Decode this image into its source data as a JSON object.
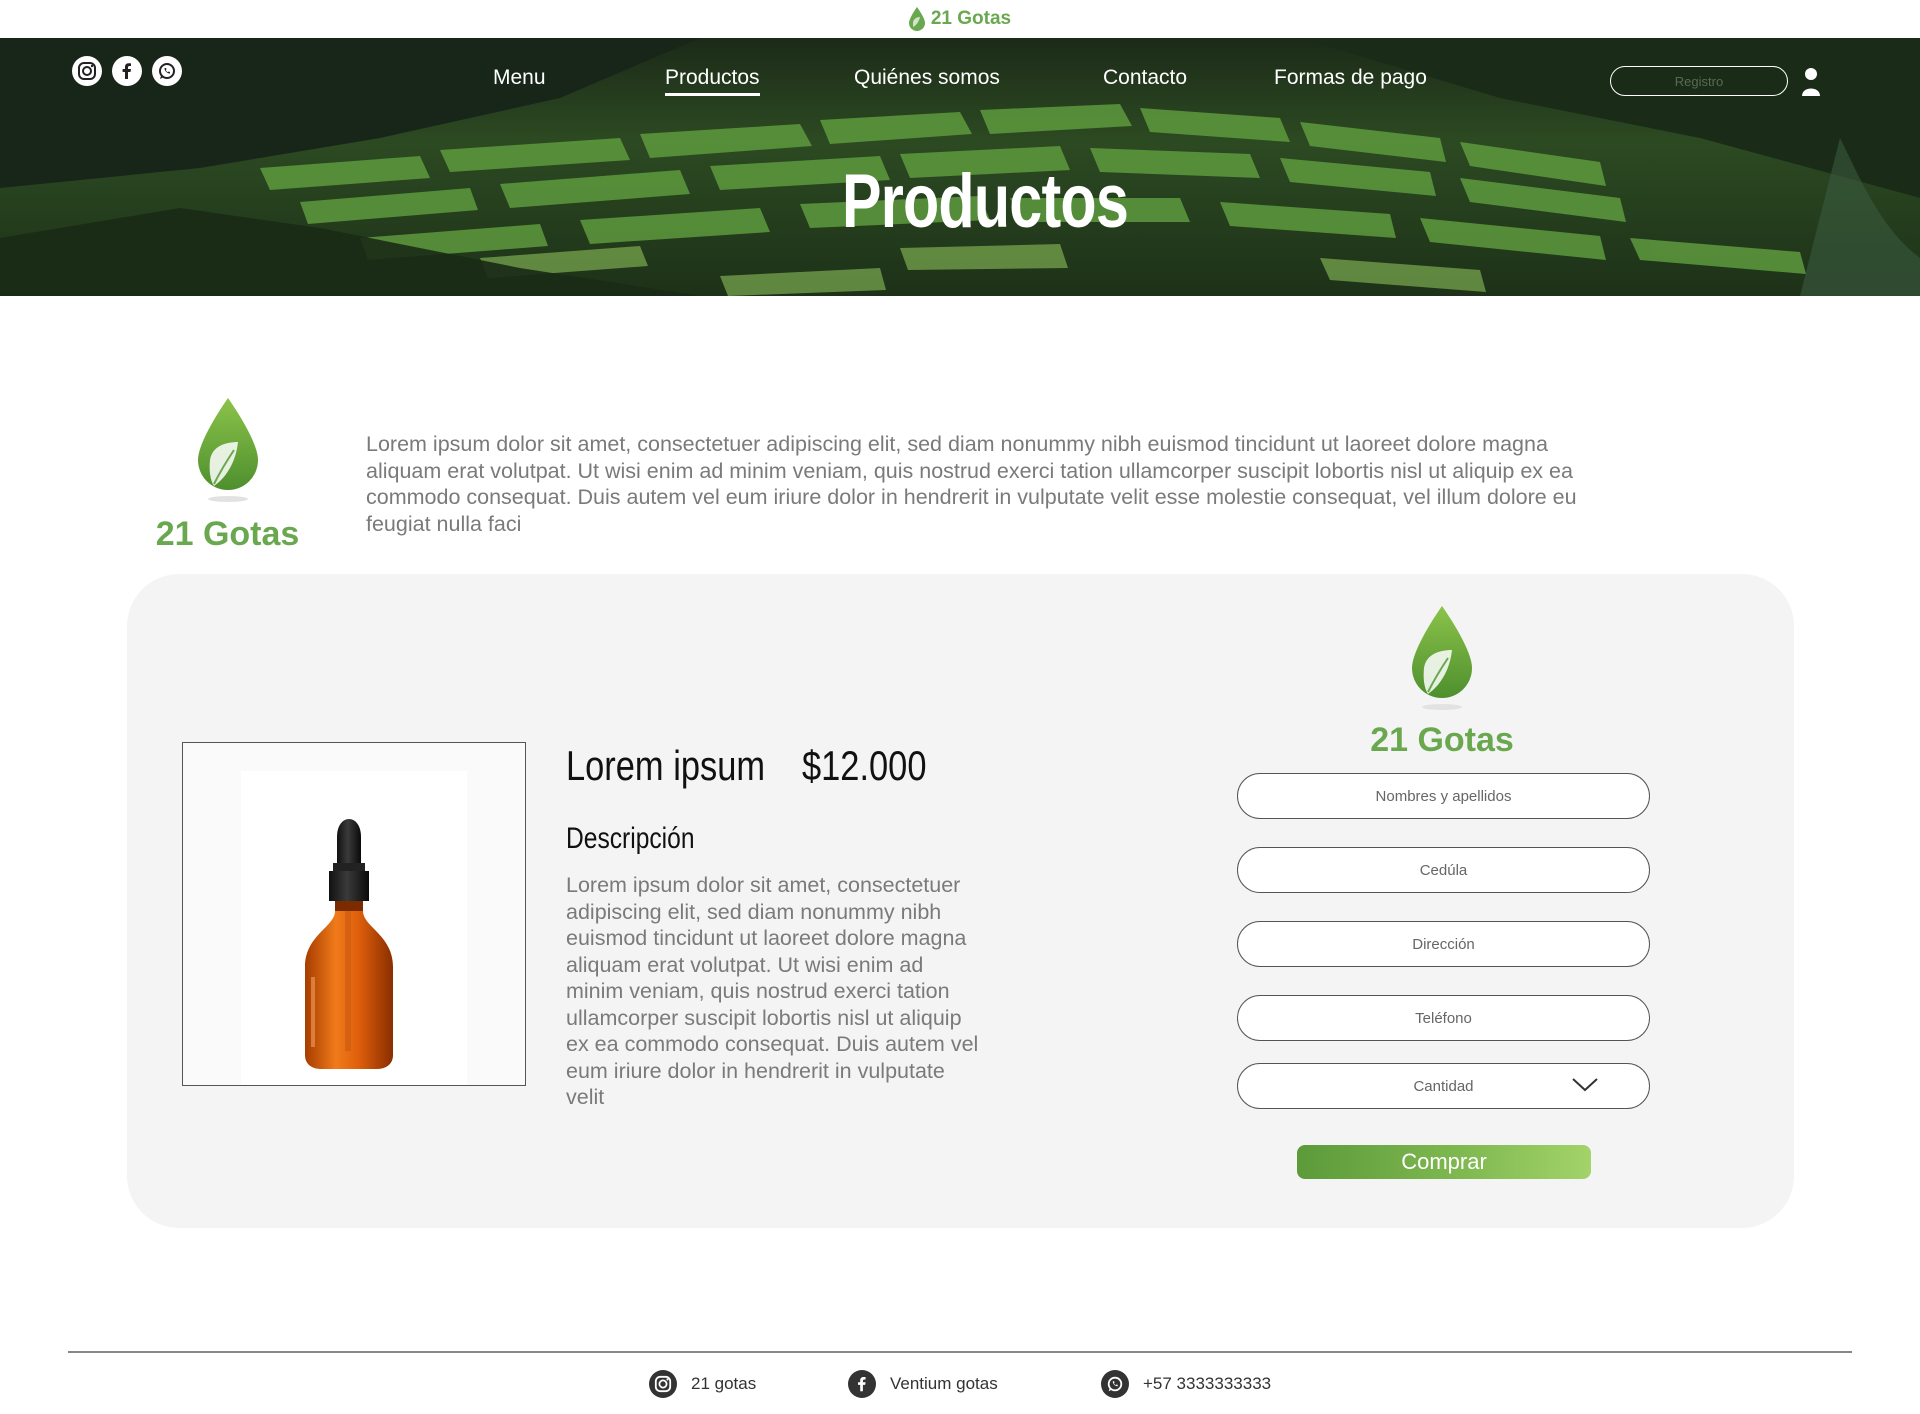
{
  "brand": {
    "name": "21 Gotas"
  },
  "header": {
    "social_icons": [
      "instagram-icon",
      "facebook-icon",
      "whatsapp-icon"
    ],
    "nav": [
      {
        "label": "Menu"
      },
      {
        "label": "Productos",
        "active": true
      },
      {
        "label": "Quiénes somos"
      },
      {
        "label": "Contacto"
      },
      {
        "label": "Formas de pago"
      }
    ],
    "registro_placeholder": "Registro",
    "user_icon": "user-icon"
  },
  "hero": {
    "title": "Productos"
  },
  "intro": {
    "text": "Lorem ipsum dolor sit amet, consectetuer adipiscing elit, sed diam nonummy nibh euismod tincidunt ut laoreet dolore magna aliquam erat volutpat. Ut wisi enim ad minim veniam, quis nostrud exerci tation ullamcorper suscipit lobortis nisl ut aliquip ex ea commodo consequat. Duis autem vel eum iriure dolor in hendrerit in vulputate velit esse molestie consequat, vel illum dolore eu feugiat nulla faci"
  },
  "product": {
    "name": "Lorem ipsum",
    "price": "$12.000",
    "description_heading": "Descripción",
    "description": "Lorem ipsum dolor sit amet, consectetuer adipiscing elit, sed diam nonummy nibh euismod tincidunt ut laoreet dolore magna aliquam erat volutpat. Ut wisi enim ad minim veniam, quis nostrud exerci tation ullamcorper suscipit lobortis nisl ut aliquip ex ea commodo consequat. Duis autem vel eum iriure dolor in hendrerit in vulputate velit"
  },
  "form": {
    "name_placeholder": "Nombres y apellidos",
    "id_placeholder": "Cedúla",
    "address_placeholder": "Dirección",
    "phone_placeholder": "Teléfono",
    "quantity_placeholder": "Cantidad",
    "buy_label": "Comprar"
  },
  "footer": {
    "instagram": "21 gotas",
    "facebook": "Ventium gotas",
    "whatsapp": "+57 3333333333"
  },
  "colors": {
    "brand_green": "#6aa84f",
    "card_bg": "#f4f4f4"
  }
}
